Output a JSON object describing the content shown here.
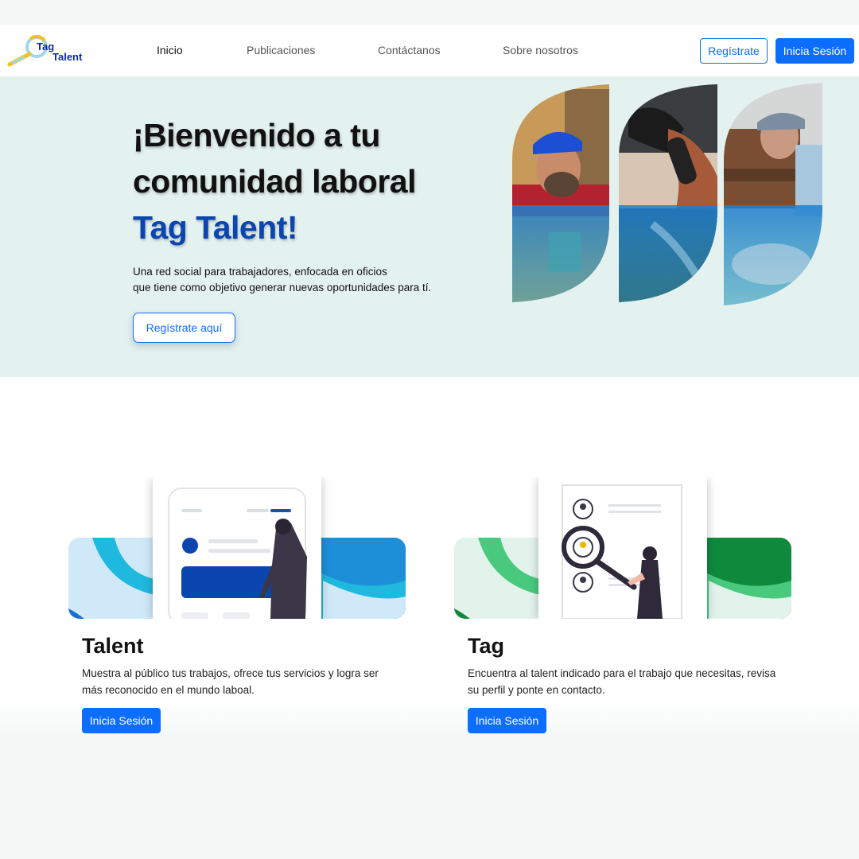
{
  "brand": {
    "logo_line1": "Tag",
    "logo_line2": "Talent",
    "primary_color": "#0d6efd",
    "brand_dark": "#0b45b0"
  },
  "nav": {
    "links": [
      "Inicio",
      "Publicaciones",
      "Contáctanos",
      "Sobre nosotros"
    ],
    "active": "Inicio",
    "register_label": "Regístrate",
    "login_label": "Inicia Sesión"
  },
  "hero": {
    "title_line1": "¡Bienvenido a tu",
    "title_line2": "comunidad laboral",
    "title_line3": "Tag Talent!",
    "desc_line1": "Una red social para trabajadores, enfocada en oficios",
    "desc_line2": "que tiene como objetivo generar nuevas oportunidades para tí.",
    "cta_label": "Regístrate aquí",
    "image_icons": [
      "mechanic-worker-photo",
      "hairdresser-photo",
      "carpenter-photo"
    ]
  },
  "features": [
    {
      "title": "Talent",
      "description": "Muestra al público tus trabajos, ofrece tus servicios y logra ser más reconocido en el mundo laboal.",
      "button_label": "Inicia Sesión",
      "accent": "#1ab7e0"
    },
    {
      "title": "Tag",
      "description": "Encuentra al talent indicado para el trabajo que necesitas, revisa su perfil y ponte en contacto.",
      "button_label": "Inicia Sesión",
      "accent": "#2fbf71"
    }
  ]
}
